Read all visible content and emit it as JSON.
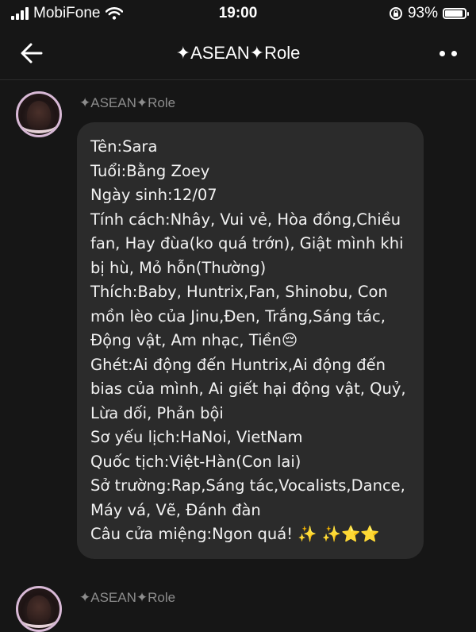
{
  "status_bar": {
    "carrier": "MobiFone",
    "time": "19:00",
    "battery_percent": "93%",
    "battery_level": 0.93
  },
  "nav": {
    "title": "✦ASEAN✦Role",
    "back_icon": "arrow-left-icon",
    "more_icon": "more-dots-icon"
  },
  "messages": [
    {
      "author": "✦ASEAN✦Role",
      "lines": [
        "Tên:Sara",
        "Tuổi:Bằng Zoey",
        "Ngày sinh:12/07",
        "Tính cách:Nhây, Vui vẻ, Hòa đồng,Chiều",
        "fan, Hay đùa(ko quá trớn), Giật mình khi",
        "bị hù, Mỏ hỗn(Thường)",
        "Thích:Baby, Huntrix,Fan, Shinobu, Con",
        "mồn lèo của Jinu,Đen, Trắng,Sáng tác,",
        "Động vật, Am nhạc, Tiền😔",
        "Ghét:Ai động đến Huntrix,Ai động đến",
        "bias của mình, Ai giết hại động vật, Quỷ,",
        "Lừa dối, Phản bội",
        "Sơ yếu lịch:HaNoi, VietNam",
        "Quốc tịch:Việt-Hàn(Con lai)",
        "Sở trường:Rap,Sáng tác,Vocalists,Dance,",
        "Máy vá, Vẽ, Đánh đàn",
        "Câu cửa miệng:Ngon quá! ✨ ✨⭐⭐"
      ]
    },
    {
      "author": "✦ASEAN✦Role"
    }
  ]
}
